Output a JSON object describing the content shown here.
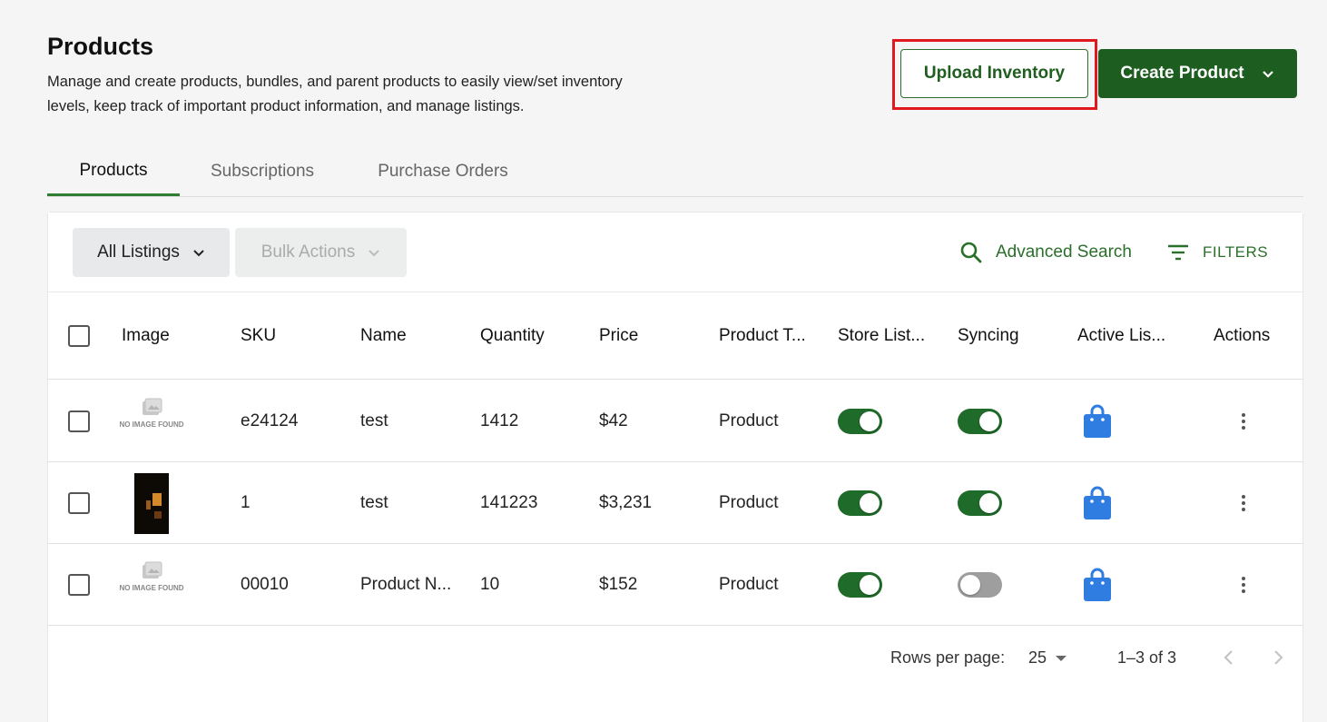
{
  "header": {
    "title": "Products",
    "description": "Manage and create products, bundles, and parent products to easily view/set inventory levels, keep track of important product information, and manage listings.",
    "upload_label": "Upload Inventory",
    "create_label": "Create Product"
  },
  "tabs": [
    {
      "label": "Products",
      "active": true
    },
    {
      "label": "Subscriptions",
      "active": false
    },
    {
      "label": "Purchase Orders",
      "active": false
    }
  ],
  "toolbar": {
    "listings_label": "All Listings",
    "bulk_label": "Bulk Actions",
    "advanced_search_label": "Advanced Search",
    "filters_label": "FILTERS"
  },
  "table": {
    "columns": [
      "Image",
      "SKU",
      "Name",
      "Quantity",
      "Price",
      "Product T...",
      "Store List...",
      "Syncing",
      "Active Lis...",
      "Actions"
    ],
    "no_image_text": "NO IMAGE FOUND",
    "rows": [
      {
        "image": "no-image",
        "sku": "e24124",
        "name": "test",
        "quantity": "1412",
        "price": "$42",
        "type": "Product",
        "store_listing": true,
        "syncing": true
      },
      {
        "image": "photo",
        "sku": "1",
        "name": "test",
        "quantity": "141223",
        "price": "$3,231",
        "type": "Product",
        "store_listing": true,
        "syncing": true
      },
      {
        "image": "no-image",
        "sku": "00010",
        "name": "Product N...",
        "quantity": "10",
        "price": "$152",
        "type": "Product",
        "store_listing": true,
        "syncing": false
      }
    ]
  },
  "pagination": {
    "rows_per_page_label": "Rows per page:",
    "rows_per_page_value": "25",
    "range_text": "1–3 of 3"
  },
  "colors": {
    "primary_green": "#1d5e20",
    "link_green": "#2a6f2a",
    "highlight_red": "#e0191f",
    "bag_blue": "#2f7de1"
  }
}
